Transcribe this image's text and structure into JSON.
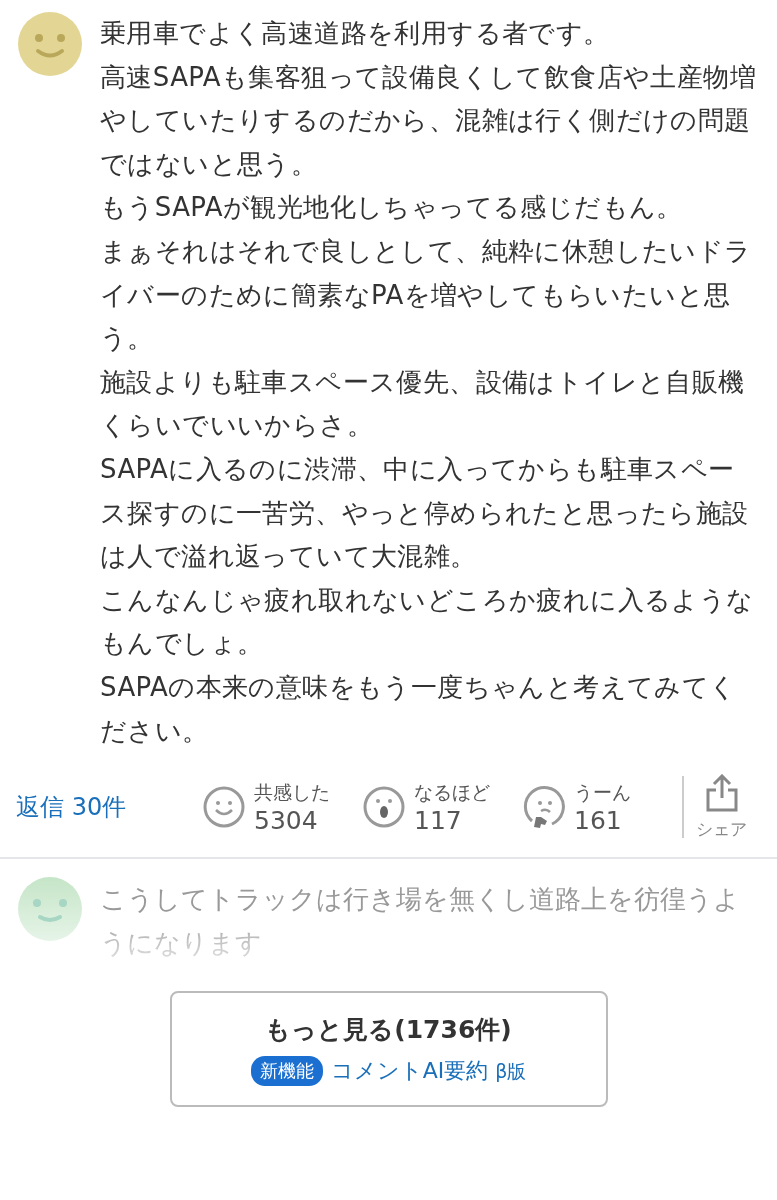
{
  "comment": {
    "paragraphs": [
      "乗用車でよく高速道路を利用する者です。",
      "高速SAPAも集客狙って設備良くして飲食店や土産物増やしていたりするのだから、混雑は行く側だけの問題ではないと思う。",
      "もうSAPAが観光地化しちゃってる感じだもん。",
      "まぁそれはそれで良しとして、純粋に休憩したいドライバーのために簡素なPAを増やしてもらいたいと思う。",
      "施設よりも駐車スペース優先、設備はトイレと自販機くらいでいいからさ。",
      "SAPAに入るのに渋滞、中に入ってからも駐車スペース探すのに一苦労、やっと停められたと思ったら施設は人で溢れ返っていて大混雑。",
      "こんなんじゃ疲れ取れないどころか疲れに入るようなもんでしょ。",
      "SAPAの本来の意味をもう一度ちゃんと考えてみてください。"
    ],
    "replies": "返信 30件",
    "reactions": [
      {
        "kind": "smile",
        "label": "共感した",
        "count": "5304"
      },
      {
        "kind": "wow",
        "label": "なるほど",
        "count": "117"
      },
      {
        "kind": "hmm",
        "label": "うーん",
        "count": "161"
      }
    ],
    "share": "シェア"
  },
  "next_comment": {
    "text": "こうしてトラックは行き場を無くし道路上を彷徨うようになります"
  },
  "more_button": {
    "label": "もっと見る(1736件)",
    "badge": "新機能",
    "link": "コメントAI要約",
    "beta": "β版"
  }
}
